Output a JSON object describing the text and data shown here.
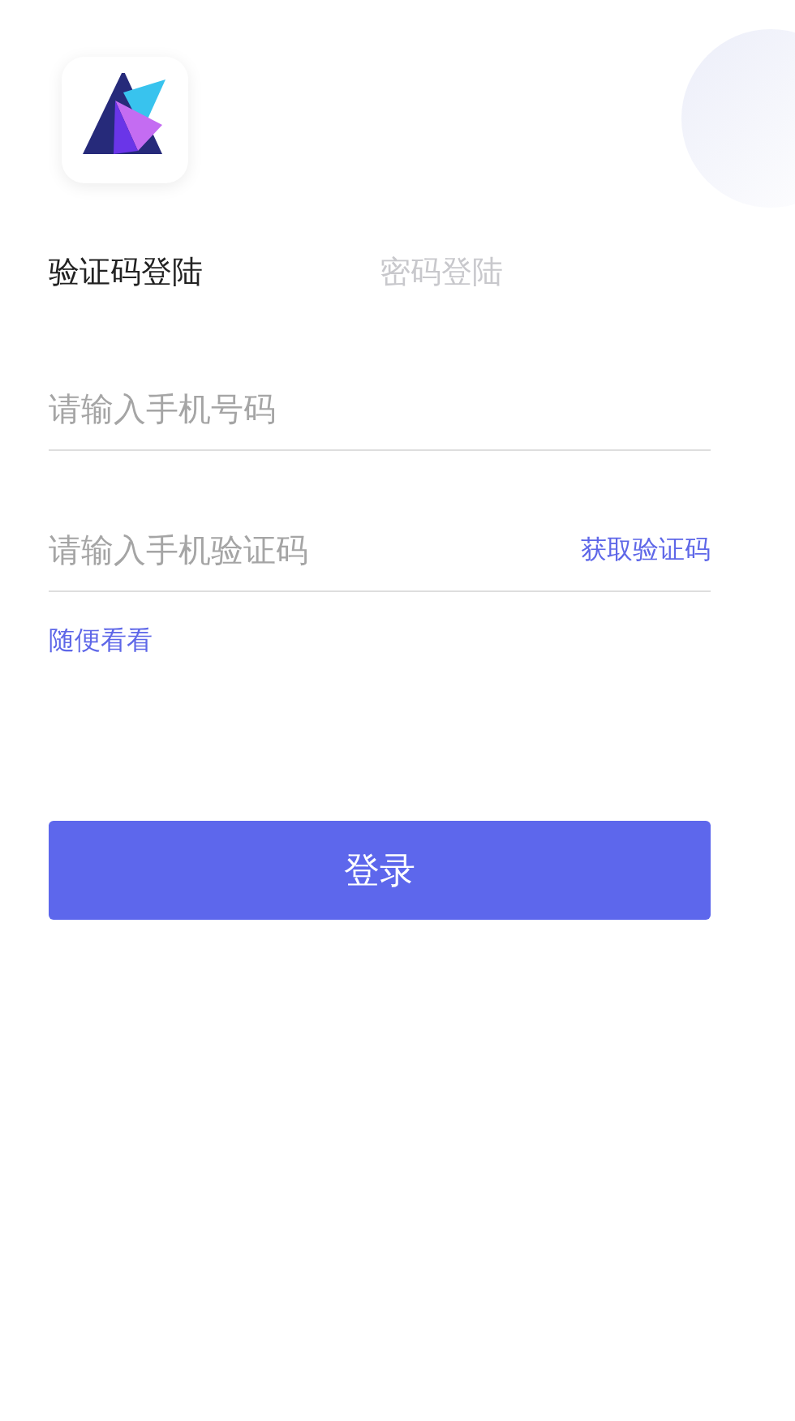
{
  "tabs": [
    {
      "label": "验证码登陆",
      "selected": true
    },
    {
      "label": "密码登陆",
      "selected": false
    }
  ],
  "phone_field": {
    "placeholder": "请输入手机号码"
  },
  "code_field": {
    "placeholder": "请输入手机验证码",
    "action": "获取验证码"
  },
  "browse_link": "随便看看",
  "login_button": "登录"
}
